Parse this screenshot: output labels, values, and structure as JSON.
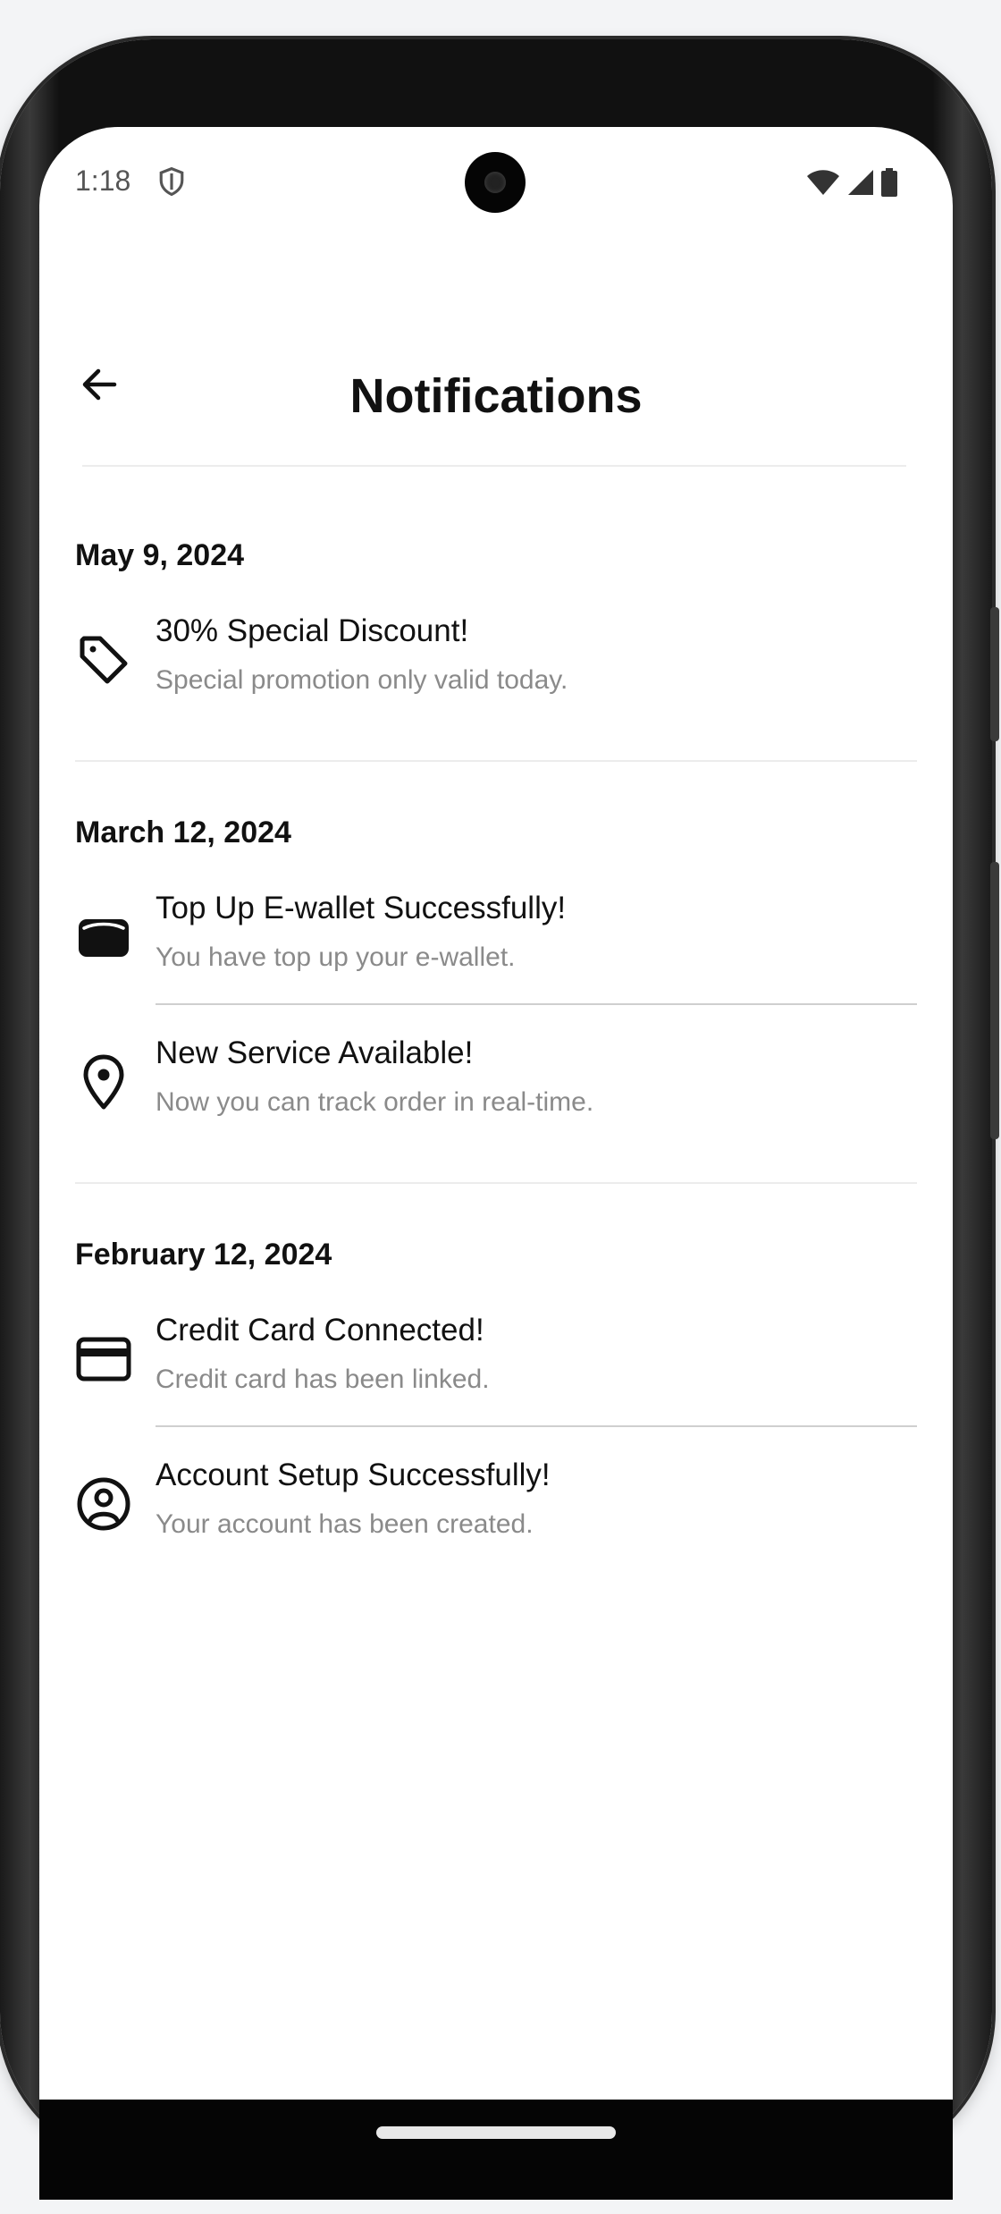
{
  "status_bar": {
    "time": "1:18",
    "icons": [
      "shield-icon",
      "wifi-icon",
      "signal-icon",
      "battery-icon"
    ]
  },
  "header": {
    "title": "Notifications",
    "back_icon": "arrow-left-icon"
  },
  "sections": [
    {
      "date": "May 9, 2024",
      "items": [
        {
          "icon": "tag-icon",
          "title": "30% Special Discount!",
          "description": "Special promotion only valid today."
        }
      ]
    },
    {
      "date": "March 12, 2024",
      "items": [
        {
          "icon": "wallet-icon",
          "title": "Top Up E-wallet Successfully!",
          "description": "You have top up your e-wallet."
        },
        {
          "icon": "location-pin-icon",
          "title": "New Service Available!",
          "description": "Now you can track order in real-time."
        }
      ]
    },
    {
      "date": "February 12, 2024",
      "items": [
        {
          "icon": "credit-card-icon",
          "title": "Credit Card Connected!",
          "description": "Credit card has been linked."
        },
        {
          "icon": "user-circle-icon",
          "title": "Account Setup Successfully!",
          "description": "Your account has been created."
        }
      ]
    }
  ],
  "colors": {
    "text_primary": "#111111",
    "text_secondary": "#8a8a8a",
    "divider": "#cfcfcf",
    "background": "#ffffff"
  }
}
